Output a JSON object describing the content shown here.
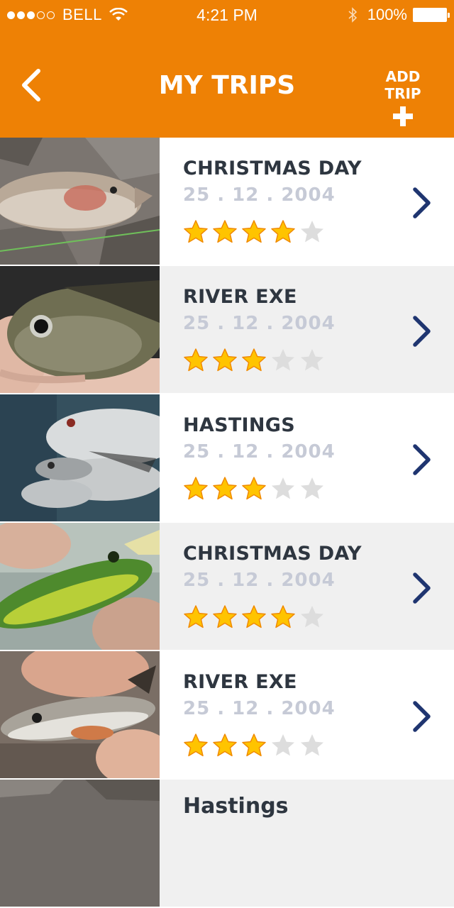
{
  "status_bar": {
    "carrier": "BELL",
    "time": "4:21 PM",
    "battery": "100%"
  },
  "header": {
    "title": "MY TRIPS",
    "add_trip_label": "ADD TRIP",
    "background_color": "#ee8105"
  },
  "trips": [
    {
      "name": "CHRISTMAS DAY",
      "date": "25 . 12 . 2004",
      "rating": 4,
      "max_rating": 5,
      "photo": "rainbow-trout"
    },
    {
      "name": "RIVER EXE",
      "date": "25 . 12 . 2004",
      "rating": 3,
      "max_rating": 5,
      "photo": "bluegill"
    },
    {
      "name": "HASTINGS",
      "date": "25 . 12 . 2004",
      "rating": 3,
      "max_rating": 5,
      "photo": "roach-catch"
    },
    {
      "name": "CHRISTMAS DAY",
      "date": "25 . 12 . 2004",
      "rating": 4,
      "max_rating": 5,
      "photo": "green-fish-with-fly"
    },
    {
      "name": "RIVER EXE",
      "date": "25 . 12 . 2004",
      "rating": 3,
      "max_rating": 5,
      "photo": "small-trout-in-hand"
    }
  ],
  "partial_trip": {
    "name": "Hastings"
  },
  "colors": {
    "star_filled": "#ffc400",
    "star_empty": "#dddddd",
    "chevron": "#1f3570",
    "title_text": "#2e3640",
    "date_text": "#c6cad6"
  }
}
